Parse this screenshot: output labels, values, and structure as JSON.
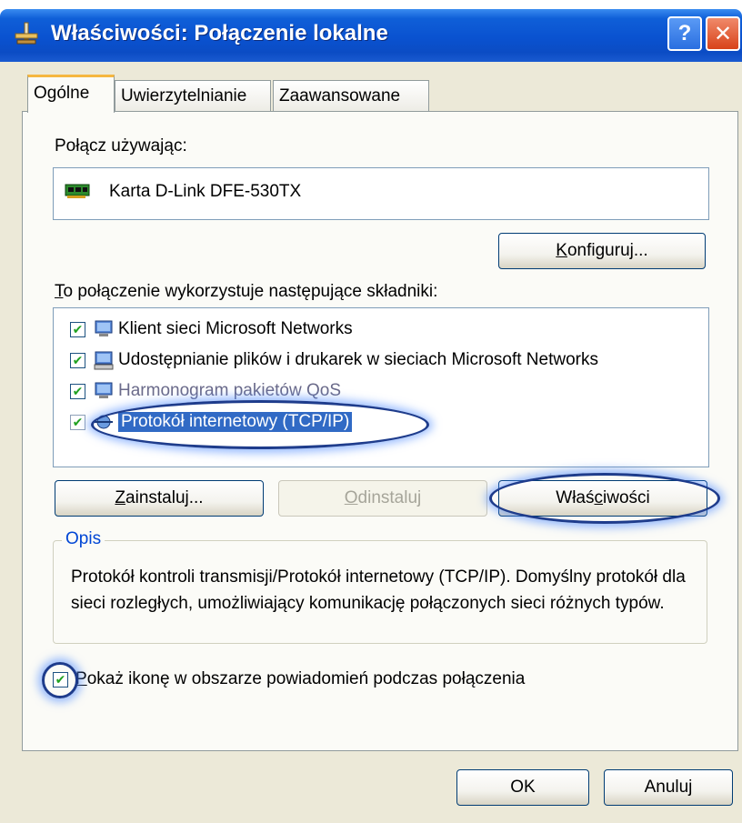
{
  "window": {
    "title": "Właściwości: Połączenie lokalne",
    "help_label": "?",
    "close_label": "✕"
  },
  "tabs": [
    {
      "label": "Ogólne",
      "active": true
    },
    {
      "label": "Uwierzytelnianie",
      "active": false
    },
    {
      "label": "Zaawansowane",
      "active": false
    }
  ],
  "connect_using": {
    "label": "Połącz używając:",
    "adapter_name": "Karta D-Link DFE-530TX",
    "adapter_icon": "network-card-icon"
  },
  "configure_button": {
    "prefix": "",
    "accel": "K",
    "rest": "onfiguruj..."
  },
  "components": {
    "label_accel": "T",
    "label_rest": "o połączenie wykorzystuje następujące składniki:",
    "items": [
      {
        "label": "Klient sieci Microsoft Networks",
        "checked": true,
        "icon": "network-client-icon",
        "selected": false
      },
      {
        "label": "Udostępnianie plików i drukarek w sieciach Microsoft Networks",
        "checked": true,
        "icon": "file-printer-sharing-icon",
        "selected": false
      },
      {
        "label": "Harmonogram pakietów QoS",
        "checked": true,
        "icon": "qos-scheduler-icon",
        "selected": false
      },
      {
        "label": "Protokół internetowy (TCP/IP)",
        "checked": true,
        "icon": "protocol-icon",
        "selected": true
      }
    ]
  },
  "buttons": {
    "install": {
      "accel": "Z",
      "rest": "ainstaluj..."
    },
    "uninstall": {
      "accel": "O",
      "rest": "dinstaluj",
      "disabled": true
    },
    "properties": {
      "prefix": "Właś",
      "accel": "c",
      "rest": "iwości"
    }
  },
  "description": {
    "legend": "Opis",
    "text": "Protokół kontroli transmisji/Protokół internetowy (TCP/IP). Domyślny protokół dla sieci rozległych, umożliwiający komunikację połączonych sieci różnych typów."
  },
  "show_icon_checkbox": {
    "checked": true,
    "accel": "P",
    "rest": "okaż ikonę w obszarze powiadomień podczas połączenia"
  },
  "footer": {
    "ok_label": "OK",
    "cancel_label": "Anuluj"
  },
  "colors": {
    "titlebar": "#0a52d0",
    "dialog_bg": "#ece9d8",
    "selection": "#316ac5",
    "groupbox_legend": "#0046d5",
    "annotation_ring": "#1e3c8c"
  }
}
